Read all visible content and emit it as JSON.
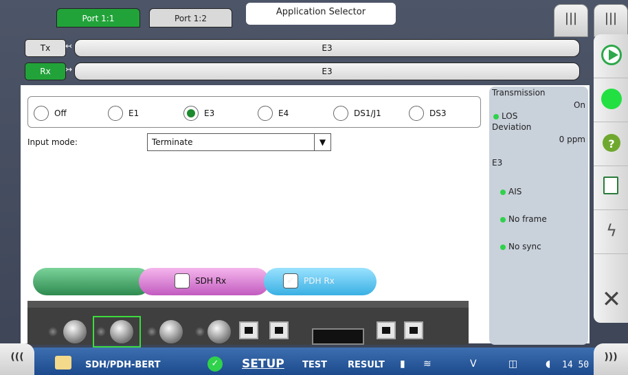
{
  "tabs": {
    "port1": "Port 1:1",
    "port2": "Port 1:2",
    "app_selector": "Application Selector"
  },
  "menu": {
    "glyph": "|||"
  },
  "rows": {
    "tx": {
      "label": "Tx",
      "value": "E3"
    },
    "rx": {
      "label": "Rx",
      "value": "E3"
    }
  },
  "rate_options": [
    {
      "label": "Off",
      "selected": false
    },
    {
      "label": "E1",
      "selected": false
    },
    {
      "label": "E3",
      "selected": true
    },
    {
      "label": "E4",
      "selected": false
    },
    {
      "label": "DS1/J1",
      "selected": false
    },
    {
      "label": "DS3",
      "selected": false
    }
  ],
  "input_mode": {
    "label": "Input mode:",
    "value": "Terminate"
  },
  "status": {
    "transmission_label": "Transmission",
    "transmission_value": "On",
    "los": "LOS",
    "deviation_label": "Deviation",
    "deviation_value": "0 ppm",
    "e3_header": "E3",
    "ais": "AIS",
    "no_frame": "No frame",
    "no_sync": "No sync"
  },
  "pipes": {
    "sdh": "SDH Rx",
    "pdh": "PDH Rx",
    "sdh_checked": false,
    "pdh_checked": true
  },
  "bottom": {
    "app": "SDH/PDH-BERT",
    "setup": "SETUP",
    "test": "TEST",
    "result": "RESULT",
    "time": "14 50",
    "left_chevron": "(((",
    "right_chevron": ")))"
  },
  "colors": {
    "accent_green": "#22a33a",
    "status_bar": "#1c4a8d",
    "panel": "#c9d1db"
  }
}
